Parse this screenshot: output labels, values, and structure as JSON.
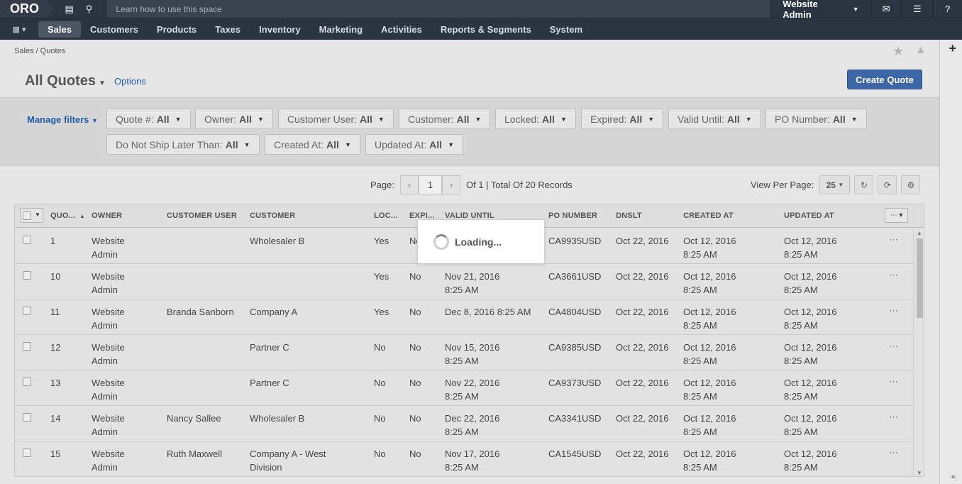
{
  "topbar": {
    "logo": "ORO",
    "search_placeholder": "Learn how to use this space",
    "user": "Website Admin"
  },
  "nav": {
    "items": [
      "Sales",
      "Customers",
      "Products",
      "Taxes",
      "Inventory",
      "Marketing",
      "Activities",
      "Reports & Segments",
      "System"
    ],
    "active": "Sales"
  },
  "breadcrumb": "Sales / Quotes",
  "page": {
    "title": "All Quotes",
    "options": "Options",
    "create": "Create Quote"
  },
  "filters": {
    "manage": "Manage filters",
    "chips": [
      {
        "label": "Quote #:",
        "value": "All"
      },
      {
        "label": "Owner:",
        "value": "All"
      },
      {
        "label": "Customer User:",
        "value": "All"
      },
      {
        "label": "Customer:",
        "value": "All"
      },
      {
        "label": "Locked:",
        "value": "All"
      },
      {
        "label": "Expired:",
        "value": "All"
      },
      {
        "label": "Valid Until:",
        "value": "All"
      },
      {
        "label": "PO Number:",
        "value": "All"
      },
      {
        "label": "Do Not Ship Later Than:",
        "value": "All"
      },
      {
        "label": "Created At:",
        "value": "All"
      },
      {
        "label": "Updated At:",
        "value": "All"
      }
    ]
  },
  "pager": {
    "label": "Page:",
    "page": "1",
    "summary": "Of 1 | Total Of 20 Records",
    "view_per_page": "View Per Page:",
    "per_page": "25"
  },
  "columns": [
    "QUO...",
    "OWNER",
    "CUSTOMER USER",
    "CUSTOMER",
    "LOC...",
    "EXPI...",
    "VALID UNTIL",
    "PO NUMBER",
    "DNSLT",
    "CREATED AT",
    "UPDATED AT"
  ],
  "rows": [
    {
      "id": "1",
      "owner": "Website\nAdmin",
      "cuser": "",
      "customer": "Wholesaler B",
      "locked": "Yes",
      "expired": "No",
      "valid": "",
      "po": "CA9935USD",
      "dnslt": "Oct 22, 2016",
      "created": "Oct 12, 2016\n8:25 AM",
      "updated": "Oct 12, 2016\n8:25 AM"
    },
    {
      "id": "10",
      "owner": "Website\nAdmin",
      "cuser": "",
      "customer": "",
      "locked": "Yes",
      "expired": "No",
      "valid": "Nov 21, 2016\n8:25 AM",
      "po": "CA3661USD",
      "dnslt": "Oct 22, 2016",
      "created": "Oct 12, 2016\n8:25 AM",
      "updated": "Oct 12, 2016\n8:25 AM"
    },
    {
      "id": "11",
      "owner": "Website\nAdmin",
      "cuser": "Branda Sanborn",
      "customer": "Company A",
      "locked": "Yes",
      "expired": "No",
      "valid": "Dec 8, 2016 8:25 AM",
      "po": "CA4804USD",
      "dnslt": "Oct 22, 2016",
      "created": "Oct 12, 2016\n8:25 AM",
      "updated": "Oct 12, 2016\n8:25 AM"
    },
    {
      "id": "12",
      "owner": "Website\nAdmin",
      "cuser": "",
      "customer": "Partner C",
      "locked": "No",
      "expired": "No",
      "valid": "Nov 15, 2016\n8:25 AM",
      "po": "CA9385USD",
      "dnslt": "Oct 22, 2016",
      "created": "Oct 12, 2016\n8:25 AM",
      "updated": "Oct 12, 2016\n8:25 AM"
    },
    {
      "id": "13",
      "owner": "Website\nAdmin",
      "cuser": "",
      "customer": "Partner C",
      "locked": "No",
      "expired": "No",
      "valid": "Nov 22, 2016\n8:25 AM",
      "po": "CA9373USD",
      "dnslt": "Oct 22, 2016",
      "created": "Oct 12, 2016\n8:25 AM",
      "updated": "Oct 12, 2016\n8:25 AM"
    },
    {
      "id": "14",
      "owner": "Website\nAdmin",
      "cuser": "Nancy Sallee",
      "customer": "Wholesaler B",
      "locked": "No",
      "expired": "No",
      "valid": "Dec 22, 2016\n8:25 AM",
      "po": "CA3341USD",
      "dnslt": "Oct 22, 2016",
      "created": "Oct 12, 2016\n8:25 AM",
      "updated": "Oct 12, 2016\n8:25 AM"
    },
    {
      "id": "15",
      "owner": "Website\nAdmin",
      "cuser": "Ruth Maxwell",
      "customer": "Company A - West\nDivision",
      "locked": "No",
      "expired": "No",
      "valid": "Nov 17, 2016\n8:25 AM",
      "po": "CA1545USD",
      "dnslt": "Oct 22, 2016",
      "created": "Oct 12, 2016\n8:25 AM",
      "updated": "Oct 12, 2016\n8:25 AM"
    }
  ],
  "loading": "Loading..."
}
